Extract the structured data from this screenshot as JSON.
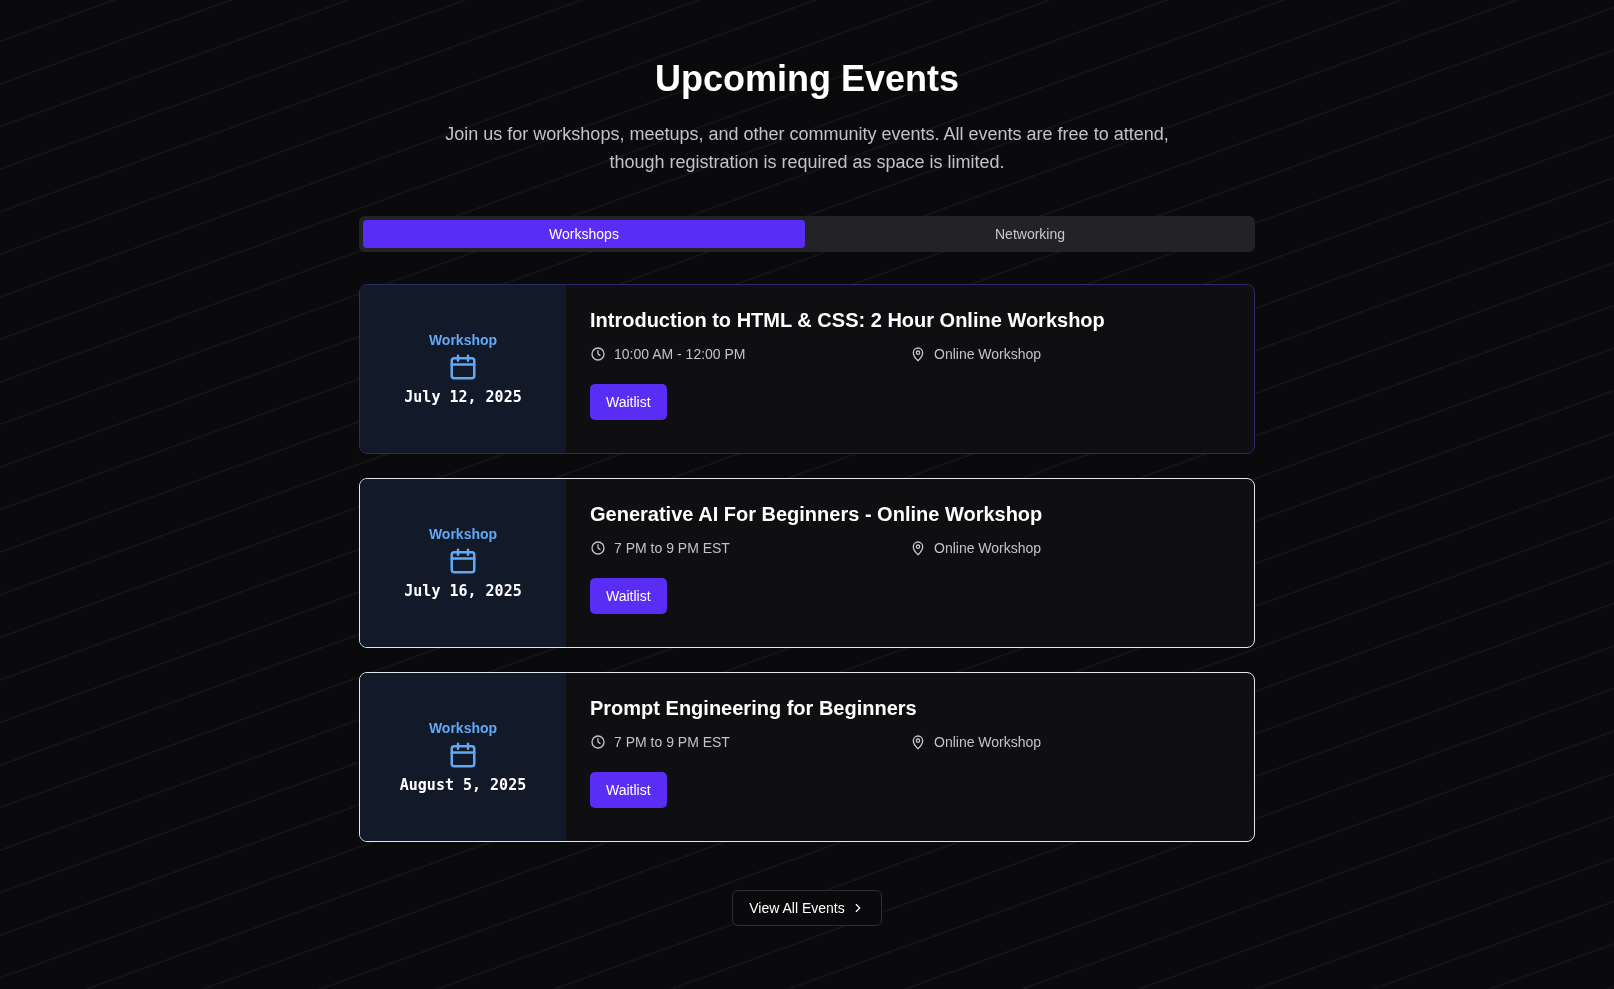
{
  "header": {
    "title": "Upcoming Events",
    "subtitle": "Join us for workshops, meetups, and other community events. All events are free to attend, though registration is required as space is limited."
  },
  "tabs": [
    {
      "label": "Workshops",
      "selected": true
    },
    {
      "label": "Networking",
      "selected": false
    }
  ],
  "events": [
    {
      "category": "Workshop",
      "date": "July 12, 2025",
      "title": "Introduction to HTML & CSS: 2 Hour Online Workshop",
      "time": "10:00 AM - 12:00 PM",
      "location": "Online Workshop",
      "button": "Waitlist",
      "highlighted": false
    },
    {
      "category": "Workshop",
      "date": "July 16, 2025",
      "title": "Generative AI For Beginners - Online Workshop",
      "time": "7 PM to 9 PM EST",
      "location": "Online Workshop",
      "button": "Waitlist",
      "highlighted": true
    },
    {
      "category": "Workshop",
      "date": "August 5, 2025",
      "title": "Prompt Engineering for Beginners",
      "time": "7 PM to 9 PM EST",
      "location": "Online Workshop",
      "button": "Waitlist",
      "highlighted": true
    }
  ],
  "view_all": {
    "label": "View All Events"
  }
}
